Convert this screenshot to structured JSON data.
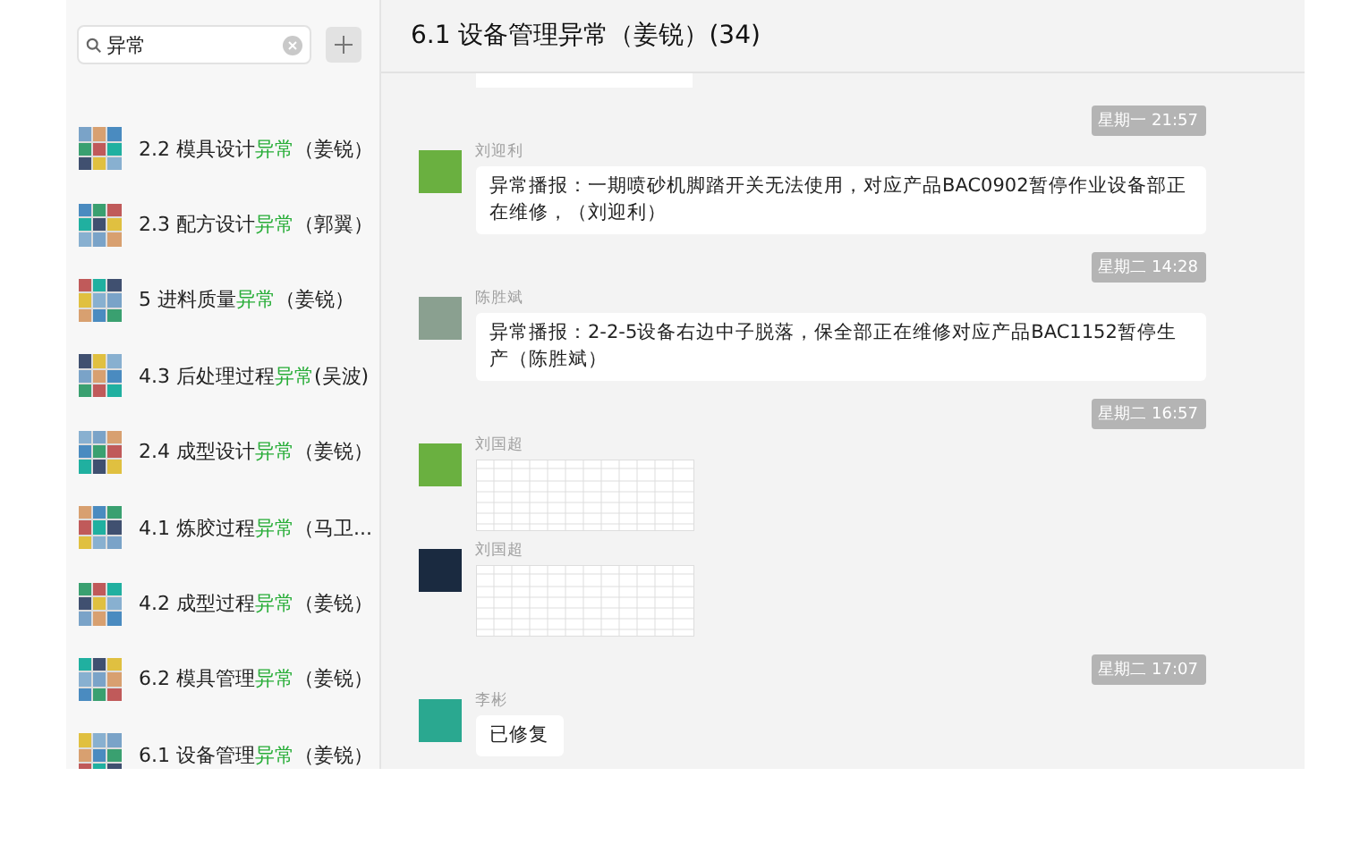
{
  "search": {
    "value": "异常"
  },
  "sidebar": {
    "items": [
      {
        "prefix": "2.2 模具设计",
        "match": "异常",
        "suffix": "（姜锐）",
        "selected": false
      },
      {
        "prefix": "2.3 配方设计",
        "match": "异常",
        "suffix": "（郭翼）",
        "selected": false
      },
      {
        "prefix": "5 进料质量",
        "match": "异常",
        "suffix": "（姜锐）",
        "selected": false
      },
      {
        "prefix": "4.3 后处理过程",
        "match": "异常",
        "suffix": "(吴波)",
        "selected": false
      },
      {
        "prefix": "2.4 成型设计",
        "match": "异常",
        "suffix": "（姜锐）",
        "selected": false
      },
      {
        "prefix": "4.1 炼胶过程",
        "match": "异常",
        "suffix": "（马卫...",
        "selected": false
      },
      {
        "prefix": "4.2 成型过程",
        "match": "异常",
        "suffix": "（姜锐）",
        "selected": false
      },
      {
        "prefix": "6.2 模具管理",
        "match": "异常",
        "suffix": "（姜锐）",
        "selected": false
      },
      {
        "prefix": "6.1 设备管理",
        "match": "异常",
        "suffix": "（姜锐）",
        "selected": false
      }
    ]
  },
  "chat": {
    "title": "6.1 设备管理异常（姜锐）(34)",
    "messages": [
      {
        "kind": "stub"
      },
      {
        "kind": "time",
        "text": "星期一 21:57"
      },
      {
        "kind": "text",
        "sender": "刘迎利",
        "text": "异常播报：一期喷砂机脚踏开关无法使用，对应产品BAC0902暂停作业设备部正在维修，（刘迎利）"
      },
      {
        "kind": "time",
        "text": "星期二 14:28"
      },
      {
        "kind": "text",
        "sender": "陈胜斌",
        "text": "异常播报：2-2-5设备右边中子脱落，保全部正在维修对应产品BAC1152暂停生产（陈胜斌）"
      },
      {
        "kind": "time",
        "text": "星期二 16:57"
      },
      {
        "kind": "image",
        "sender": "刘国超"
      },
      {
        "kind": "image",
        "sender": "刘国超"
      },
      {
        "kind": "time",
        "text": "星期二 17:07"
      },
      {
        "kind": "text",
        "sender": "李彬",
        "text": "已修复"
      }
    ]
  }
}
